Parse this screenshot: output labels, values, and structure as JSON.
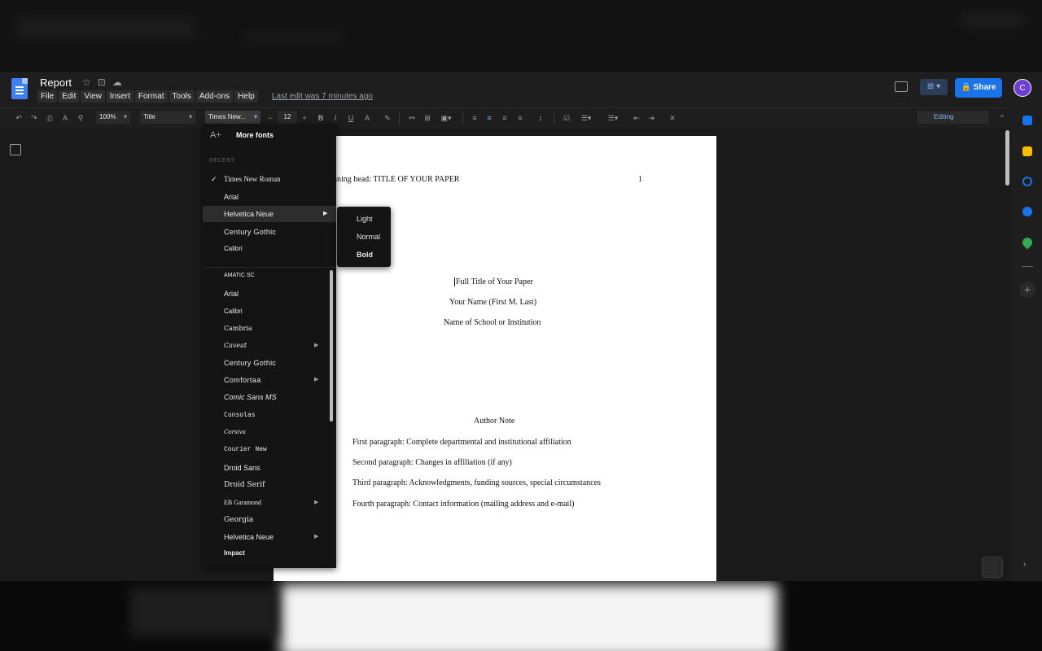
{
  "document": {
    "title": "Report",
    "last_edit": "Last edit was 7 minutes ago",
    "menu": [
      "File",
      "Edit",
      "View",
      "Insert",
      "Format",
      "Tools",
      "Add-ons",
      "Help"
    ]
  },
  "header_actions": {
    "share_label": "Share",
    "avatar_initial": "C"
  },
  "toolbar": {
    "zoom": "100%",
    "style": "Title",
    "font": "Times New...",
    "font_size": "12",
    "mode": "Editing"
  },
  "font_menu": {
    "more_fonts": "More fonts",
    "recent_heading": "RECENT",
    "recent": [
      {
        "label": "Times New Roman",
        "checked": true,
        "submenu": false
      },
      {
        "label": "Arial",
        "checked": false,
        "submenu": false
      },
      {
        "label": "Helvetica Neue",
        "checked": false,
        "submenu": true
      },
      {
        "label": "Century Gothic",
        "checked": false,
        "submenu": false
      },
      {
        "label": "Calibri",
        "checked": false,
        "submenu": false
      }
    ],
    "all": [
      {
        "label": "AMATIC SC",
        "submenu": false
      },
      {
        "label": "Arial",
        "submenu": false
      },
      {
        "label": "Calibri",
        "submenu": false
      },
      {
        "label": "Cambria",
        "submenu": false
      },
      {
        "label": "Caveat",
        "submenu": true
      },
      {
        "label": "Century Gothic",
        "submenu": false
      },
      {
        "label": "Comfortaa",
        "submenu": true
      },
      {
        "label": "Comic Sans MS",
        "submenu": false
      },
      {
        "label": "Consolas",
        "submenu": false
      },
      {
        "label": "Corsiva",
        "submenu": false
      },
      {
        "label": "Courier New",
        "submenu": false
      },
      {
        "label": "Droid Sans",
        "submenu": false
      },
      {
        "label": "Droid Serif",
        "submenu": false
      },
      {
        "label": "EB Garamond",
        "submenu": true
      },
      {
        "label": "Georgia",
        "submenu": false
      },
      {
        "label": "Helvetica Neue",
        "submenu": true
      },
      {
        "label": "Impact",
        "submenu": false
      }
    ]
  },
  "weight_submenu": [
    "Light",
    "Normal",
    "Bold"
  ],
  "page": {
    "running_head": "nning head: TITLE OF YOUR PAPER",
    "page_number": "1",
    "title": "Full Title of Your Paper",
    "author": "Your Name (First M. Last)",
    "institution": "Name of School or Institution",
    "author_note": "Author Note",
    "paragraphs": [
      "First paragraph: Complete departmental and institutional affiliation",
      "Second paragraph: Changes in affiliation (if any)",
      "Third paragraph: Acknowledgments, funding sources, special circumstances",
      "Fourth paragraph: Contact information (mailing address and e-mail)"
    ]
  }
}
